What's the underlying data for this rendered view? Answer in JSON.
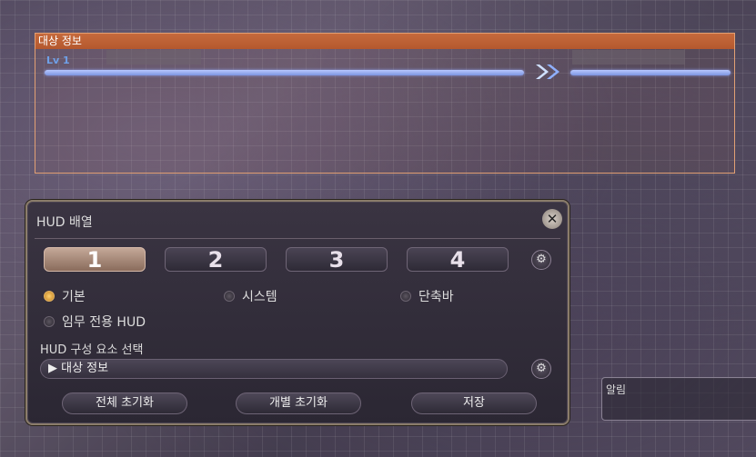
{
  "target": {
    "header": "대상 정보",
    "level": "Lv 1"
  },
  "hud": {
    "title": "HUD 배열",
    "tabs": [
      "1",
      "2",
      "3",
      "4"
    ],
    "active_tab": "1",
    "radios": {
      "basic": "기본",
      "system": "시스템",
      "hotbar": "단축바",
      "duty": "임무 전용 HUD"
    },
    "selected_radio": "기본",
    "component_label": "HUD 구성 요소 선택",
    "component_value": "▶ 대상 정보",
    "buttons": {
      "reset_all": "전체 초기화",
      "reset_one": "개별 초기화",
      "save": "저장"
    }
  },
  "notice": {
    "label": "알림"
  },
  "colors": {
    "target_header": "#b4582e",
    "hp_bar": "#8da4f0",
    "active_tab": "#b08e7c",
    "radio_on": "#e0a040"
  },
  "icons": {
    "close": "close-x-icon",
    "gear": "gear-icon",
    "arrow": "double-chevron-right-icon"
  }
}
